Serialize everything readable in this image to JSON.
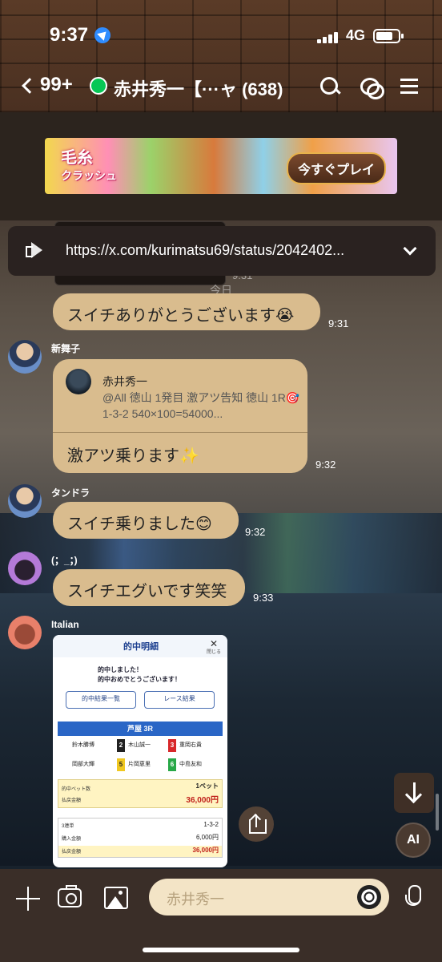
{
  "status_bar": {
    "time": "9:37",
    "network": "4G"
  },
  "header": {
    "back_count": "99+",
    "title": "赤井秀一【···ャ (638)"
  },
  "ad": {
    "logo_line1": "毛糸",
    "logo_line2": "クラッシュ",
    "cta": "今すぐプレイ"
  },
  "announcement": {
    "text": "https://x.com/kurimatsu69/status/2042402..."
  },
  "messages": [
    {
      "text": "スイチありがとうございます😭",
      "time": "9:31"
    },
    {
      "sender": "新舞子",
      "quote_name": "赤井秀一",
      "quote_text": "@All 徳山 1発目 激アツ告知 徳山 1R🎯 1-3-2 540×100=54000...",
      "text": "激アツ乗ります✨",
      "time": "9:32"
    },
    {
      "sender": "タンドラ",
      "text": "スイチ乗りました😊",
      "time": "9:32"
    },
    {
      "sender": "(；_；)",
      "text": "スイチエグいです笑笑",
      "time": "9:33"
    },
    {
      "sender": "Italian"
    }
  ],
  "faded_date": "今日",
  "prior_time": "9:31",
  "receipt": {
    "title": "的中明細",
    "close_label": "閉じる",
    "hit_line1": "的中しました！",
    "hit_line2": "的中おめでとうございます！",
    "btn_list": "的中結果一覧",
    "btn_result": "レース結果",
    "race": "芦屋 3R",
    "racers": [
      "鈴木勝博",
      "木山誠一",
      "重岡右貴",
      "岡部大輝",
      "片岡恵里",
      "中島友和"
    ],
    "racer_nums": [
      "1",
      "2",
      "3",
      "4",
      "5",
      "6"
    ],
    "bet_label": "的中ベット数",
    "bet_value": "1ベット",
    "payout_label": "払戻金額",
    "payout_value": "36,000円",
    "type_label": "3連単",
    "type_value": "1-3-2",
    "purchase_label": "購入金額",
    "purchase_value": "6,000円",
    "refund_label": "払戻金額",
    "refund_value": "36,000円"
  },
  "input": {
    "placeholder": "赤井秀一"
  },
  "ai_label": "AI",
  "colors": {
    "bubble": "#d9bc8e",
    "input_bg": "#f3e4c6",
    "line_green": "#06c755"
  }
}
